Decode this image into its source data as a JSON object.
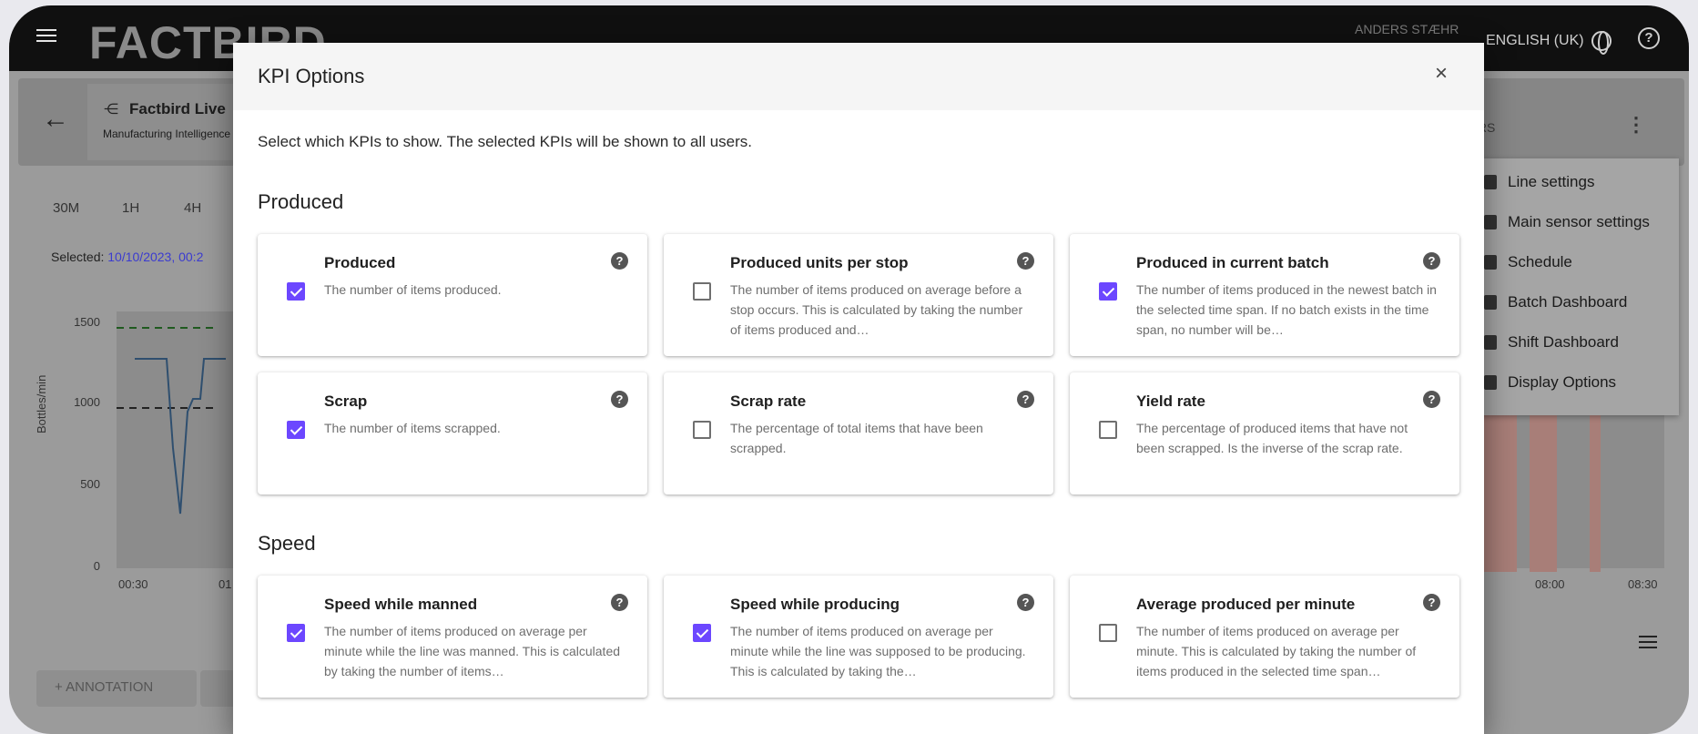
{
  "app": {
    "logo": "FACTBIRD",
    "user": "ANDERS STÆHR",
    "language": "ENGLISH (UK)",
    "line_name": "Factbird Live",
    "line_subtitle": "Manufacturing Intelligence",
    "sensors_label": "ORS"
  },
  "time_ranges": [
    "30M",
    "1H",
    "4H"
  ],
  "selected_label": "Selected:",
  "selected_date": "10/10/2023, 00:2",
  "chart_data": {
    "type": "line",
    "ylabel": "Bottles/min",
    "yticks": [
      "1500",
      "1000",
      "500",
      "0"
    ],
    "xticks_left": [
      "00:30",
      "01"
    ],
    "xticks_right": [
      "08:00",
      "08:30"
    ],
    "ylim": [
      0,
      1500
    ]
  },
  "annotation_button": "ANNOTATION",
  "dropdown": {
    "items": [
      "Line settings",
      "Main sensor settings",
      "Schedule",
      "Batch Dashboard",
      "Shift Dashboard",
      "Display Options"
    ]
  },
  "modal": {
    "title": "KPI Options",
    "close": "×",
    "description": "Select which KPIs to show. The selected KPIs will be shown to all users.",
    "help_glyph": "?",
    "sections": [
      {
        "title": "Produced",
        "cards": [
          {
            "title": "Produced",
            "desc": "The number of items produced.",
            "checked": true
          },
          {
            "title": "Produced units per stop",
            "desc": "The number of items produced on average before a stop occurs. This is calculated by taking the number of items produced and…",
            "checked": false
          },
          {
            "title": "Produced in current batch",
            "desc": "The number of items produced in the newest batch in the selected time span. If no batch exists in the time span, no number will be…",
            "checked": true
          },
          {
            "title": "Scrap",
            "desc": "The number of items scrapped.",
            "checked": true
          },
          {
            "title": "Scrap rate",
            "desc": "The percentage of total items that have been scrapped.",
            "checked": false
          },
          {
            "title": "Yield rate",
            "desc": "The percentage of produced items that have not been scrapped. Is the inverse of the scrap rate.",
            "checked": false
          }
        ]
      },
      {
        "title": "Speed",
        "cards": [
          {
            "title": "Speed while manned",
            "desc": "The number of items produced on average per minute while the line was manned. This is calculated by taking the number of items…",
            "checked": true
          },
          {
            "title": "Speed while producing",
            "desc": "The number of items produced on average per minute while the line was supposed to be producing. This is calculated by taking the…",
            "checked": true
          },
          {
            "title": "Average produced per minute",
            "desc": "The number of items produced on average per minute. This is calculated by taking the number of items produced in the selected time span…",
            "checked": false
          }
        ]
      }
    ]
  }
}
